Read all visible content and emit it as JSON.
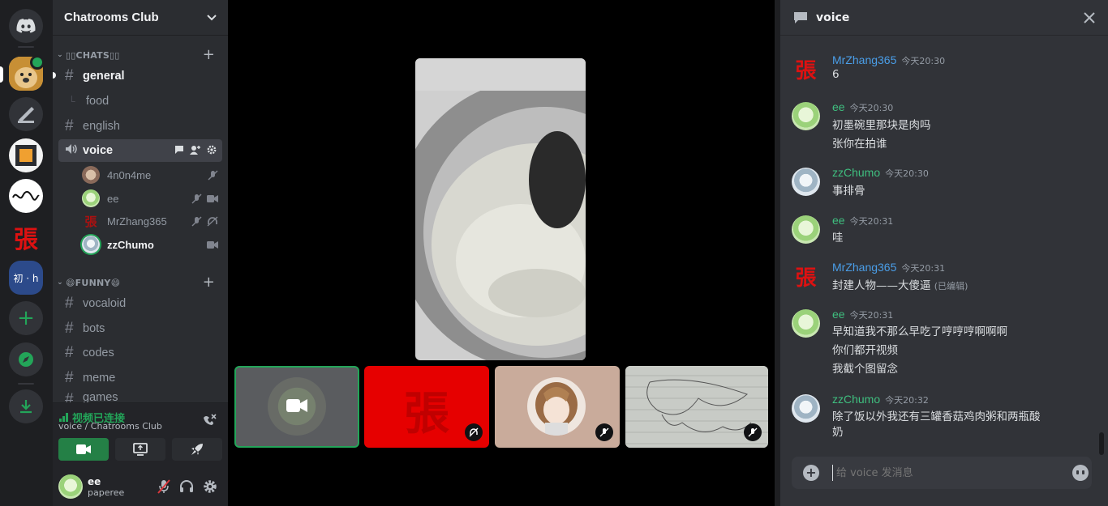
{
  "guild": {
    "name": "Chatrooms Club"
  },
  "categories": {
    "chats": {
      "label": "▯▯CHATS▯▯"
    },
    "funny": {
      "label": "😄FUNNY😄"
    }
  },
  "channels": {
    "general": "general",
    "food": "food",
    "english": "english",
    "voice": "voice",
    "vocaloid": "vocaloid",
    "bots": "bots",
    "codes": "codes",
    "meme": "meme",
    "games": "games"
  },
  "voice_users": [
    {
      "name": "4n0n4me"
    },
    {
      "name": "ee"
    },
    {
      "name": "MrZhang365"
    },
    {
      "name": "zzChumo"
    }
  ],
  "zhang_glyph": "張",
  "voice_connection": {
    "status": "视频已连接",
    "location": "voice / Chatrooms Club"
  },
  "user": {
    "name": "ee",
    "tag": "paperee"
  },
  "chat": {
    "title": "voice",
    "placeholder": "给 voice 发消息",
    "messages": [
      {
        "author": "MrZhang365",
        "time": "今天20:30",
        "color": "#4a9ee8",
        "lines": [
          "6"
        ]
      },
      {
        "author": "ee",
        "time": "今天20:30",
        "color": "#3fbf7f",
        "lines": [
          "初墨碗里那块是肉吗",
          "张你在拍谁"
        ]
      },
      {
        "author": "zzChumo",
        "time": "今天20:30",
        "color": "#3fbf7f",
        "lines": [
          "事排骨"
        ]
      },
      {
        "author": "ee",
        "time": "今天20:31",
        "color": "#3fbf7f",
        "lines": [
          "哇"
        ]
      },
      {
        "author": "MrZhang365",
        "time": "今天20:31",
        "color": "#4a9ee8",
        "lines": [
          "封建人物——大傻逼"
        ],
        "edited": "(已编辑)"
      },
      {
        "author": "ee",
        "time": "今天20:31",
        "color": "#3fbf7f",
        "lines": [
          "早知道我不那么早吃了哼哼哼啊啊啊",
          "你们都开视频",
          "我截个图留念"
        ]
      },
      {
        "author": "zzChumo",
        "time": "今天20:32",
        "color": "#3fbf7f",
        "lines": [
          "除了饭以外我还有三罐香菇鸡肉粥和两瓶酸",
          "奶"
        ]
      }
    ]
  },
  "colors": {
    "accent_green": "#248046",
    "brand": "#5865f2",
    "danger": "#da373c"
  }
}
